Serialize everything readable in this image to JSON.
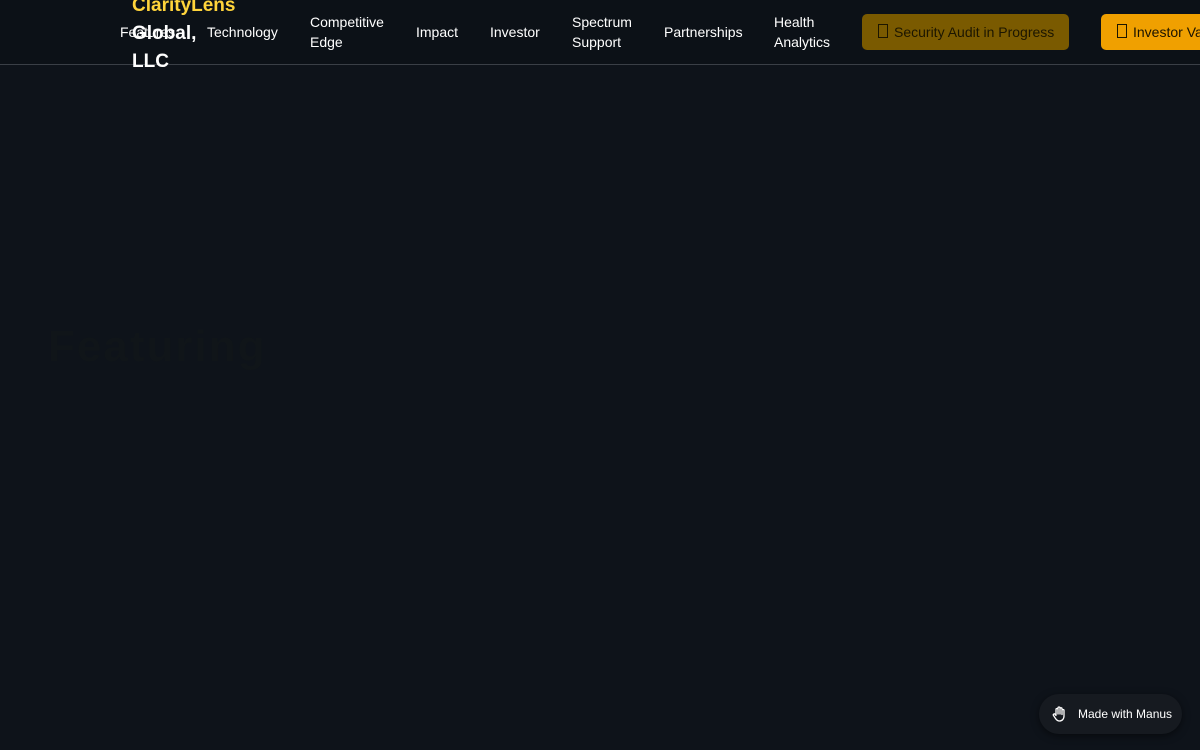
{
  "header": {
    "brand_line1": "ClarityLens",
    "brand_line2": "Global,",
    "brand_line3": "LLC",
    "nav": {
      "features": "Features",
      "technology": "Technology",
      "competitive_line1": "Competitive",
      "competitive_line2": "Edge",
      "impact": "Impact",
      "investor": "Investor",
      "spectrum_line1": "Spectrum",
      "spectrum_line2": "Support",
      "partnerships": "Partnerships",
      "health_line1": "Health",
      "health_line2": "Analytics"
    },
    "buttons": {
      "audit": "Security Audit in Progress",
      "investor": "Investor Va"
    }
  },
  "main": {
    "faint_heading": "Featuring"
  },
  "badge": {
    "label": "Made with Manus",
    "icon": "hand-icon"
  },
  "colors": {
    "background": "#0e131a",
    "brand_accent": "#ffd43b",
    "audit_button": "#7a5a00",
    "investor_button": "#f0a000"
  }
}
